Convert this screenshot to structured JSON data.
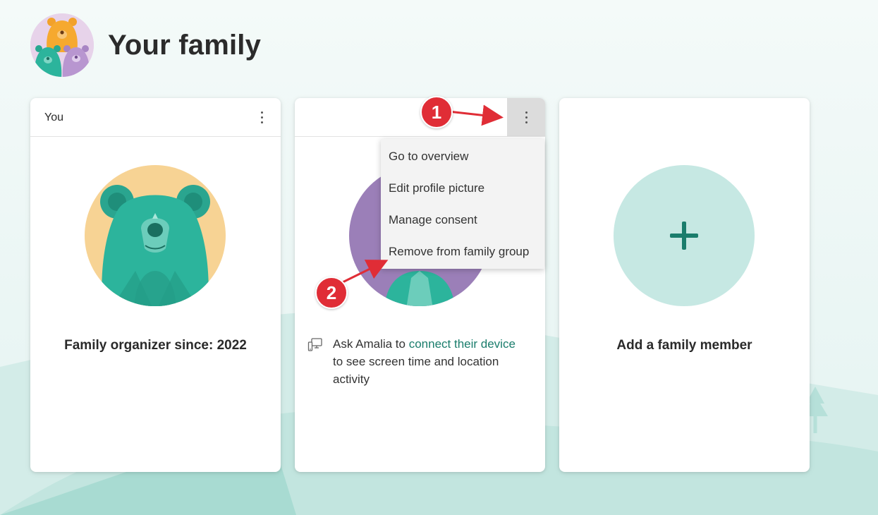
{
  "page": {
    "title": "Your family"
  },
  "cards": [
    {
      "name": "You",
      "caption": "Family organizer since: 2022"
    },
    {
      "name": "",
      "device_note": {
        "prefix": "Ask Amalia to ",
        "link": "connect their device",
        "suffix": " to see screen time and location activity"
      }
    },
    {
      "caption": "Add a family member"
    }
  ],
  "menu": {
    "items": [
      "Go to overview",
      "Edit profile picture",
      "Manage consent",
      "Remove from family group"
    ]
  },
  "annotations": {
    "step1": "1",
    "step2": "2"
  },
  "colors": {
    "accent": "#1a7d6c",
    "badge": "#e02d36",
    "bear_teal": "#2cb49c",
    "bear_bg": "#f7d394",
    "avatar_purple": "#9b7fb8",
    "add_circle": "#c6e8e3"
  },
  "icons": [
    "family-bears-avatar",
    "more-vertical-icon",
    "device-icon",
    "plus-icon",
    "tree-icon"
  ]
}
